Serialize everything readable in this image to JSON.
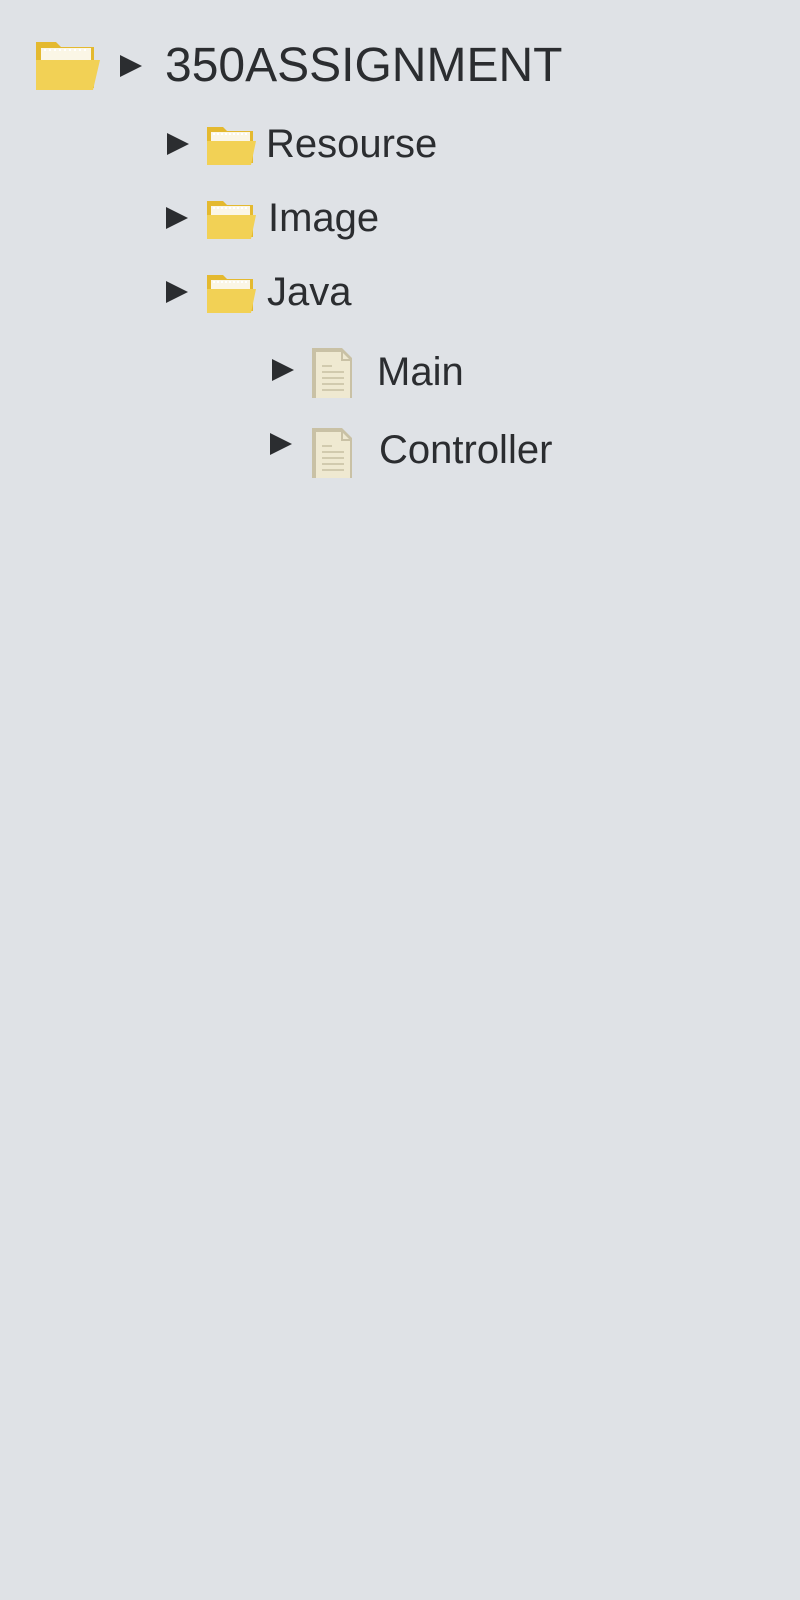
{
  "tree": {
    "root": {
      "label": "350ASSIGNMENT",
      "icon": "folder-open-icon",
      "toggle_icon": "expand-arrow-icon"
    },
    "folders": [
      {
        "label": "Resourse",
        "icon": "folder-open-icon",
        "toggle_icon": "expand-arrow-icon"
      },
      {
        "label": "Image",
        "icon": "folder-open-icon",
        "toggle_icon": "expand-arrow-icon"
      },
      {
        "label": "Java",
        "icon": "folder-open-icon",
        "toggle_icon": "expand-arrow-icon"
      }
    ],
    "files": [
      {
        "label": "Main",
        "icon": "document-icon",
        "toggle_icon": "expand-arrow-icon"
      },
      {
        "label": "Controller",
        "icon": "document-icon",
        "toggle_icon": "expand-arrow-icon"
      }
    ]
  },
  "colors": {
    "background": "#dfe2e6",
    "text": "#2b2d30",
    "arrow": "#2b2d30",
    "folder_front": "#f2d155",
    "folder_back": "#e4b92f",
    "folder_paper": "#fbf6e6",
    "document_paper": "#efe9d1",
    "document_fold": "#c9c1a5",
    "document_lines": "#c7bfa2"
  }
}
